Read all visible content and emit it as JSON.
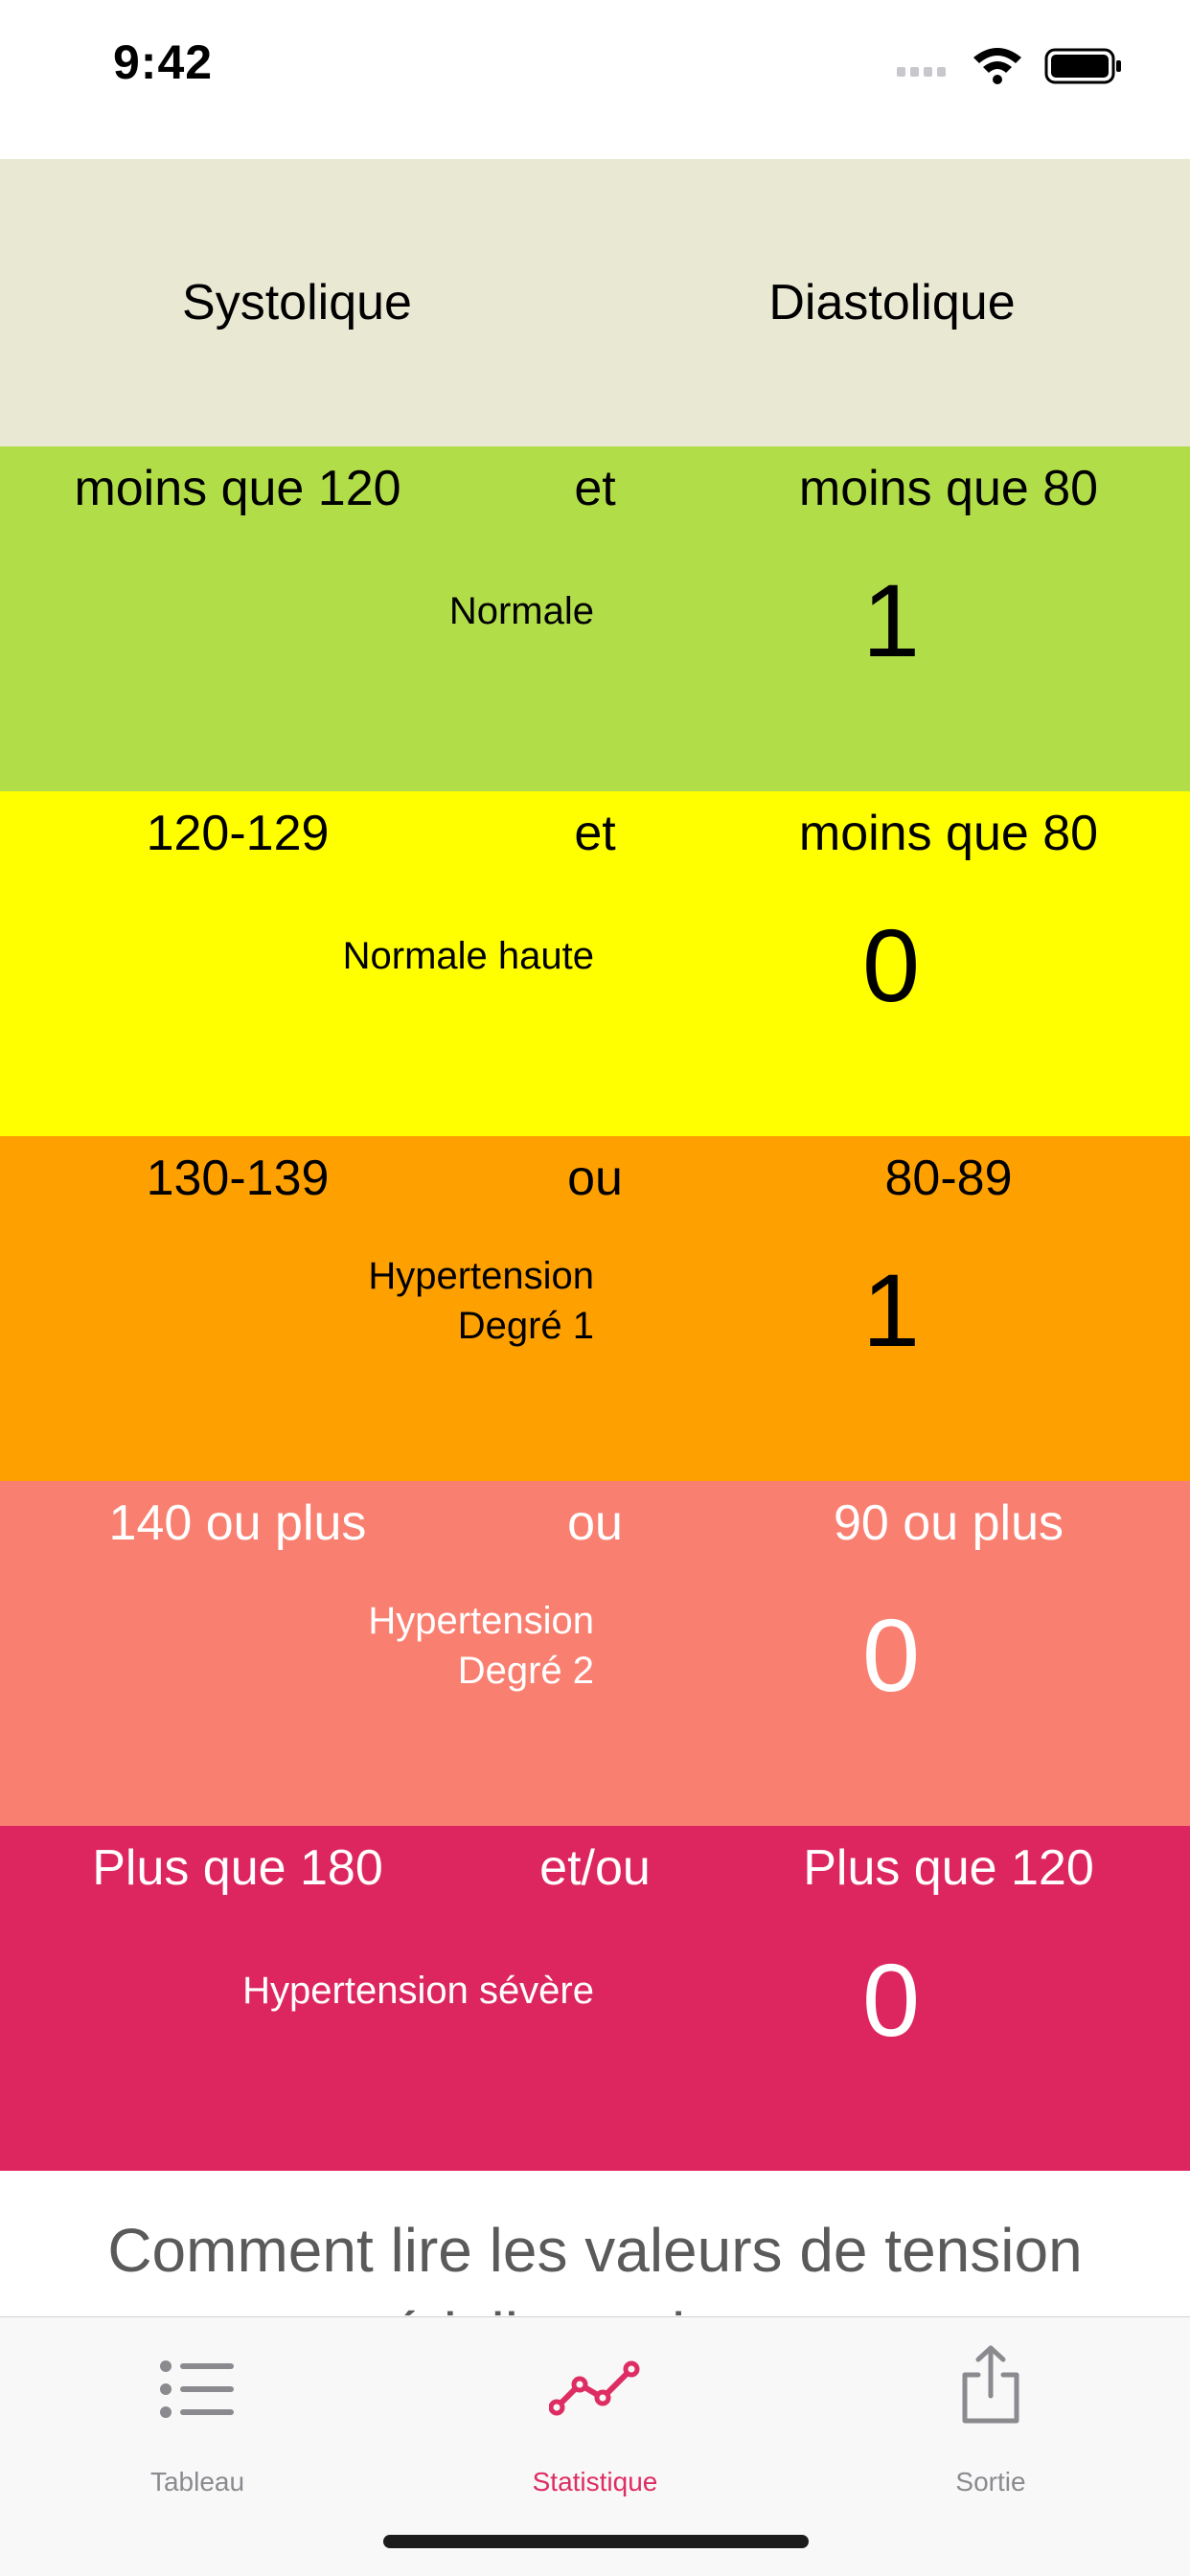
{
  "status_bar": {
    "time": "9:42"
  },
  "header": {
    "systolic": "Systolique",
    "diastolic": "Diastolique"
  },
  "bands": [
    {
      "systolic": "moins que 120",
      "connector": "et",
      "diastolic": "moins que 80",
      "category": "Normale",
      "count": "1",
      "color": "#b1dd49"
    },
    {
      "systolic": "120-129",
      "connector": "et",
      "diastolic": "moins que 80",
      "category": "Normale haute",
      "count": "0",
      "color": "#ffff00"
    },
    {
      "systolic": "130-139",
      "connector": "ou",
      "diastolic": "80-89",
      "category_line1": "Hypertension",
      "category_line2": "Degré 1",
      "count": "1",
      "color": "#fea000"
    },
    {
      "systolic": "140 ou plus",
      "connector": "ou",
      "diastolic": "90 ou plus",
      "category_line1": "Hypertension",
      "category_line2": "Degré 2",
      "count": "0",
      "color": "#f98071"
    },
    {
      "systolic": "Plus que 180",
      "connector": "et/ou",
      "diastolic": "Plus que 120",
      "category": "Hypertension sévère",
      "count": "0",
      "color": "#dd2660"
    }
  ],
  "explanation": {
    "title": "Comment lire les valeurs de tension artérielle sur le votre"
  },
  "tab_bar": {
    "tabs": [
      {
        "label": "Tableau",
        "icon": "list-icon"
      },
      {
        "label": "Statistique",
        "icon": "line-chart-icon"
      },
      {
        "label": "Sortie",
        "icon": "share-icon"
      }
    ],
    "active_color": "#dd2d63",
    "inactive_color": "#8a8a8f"
  }
}
